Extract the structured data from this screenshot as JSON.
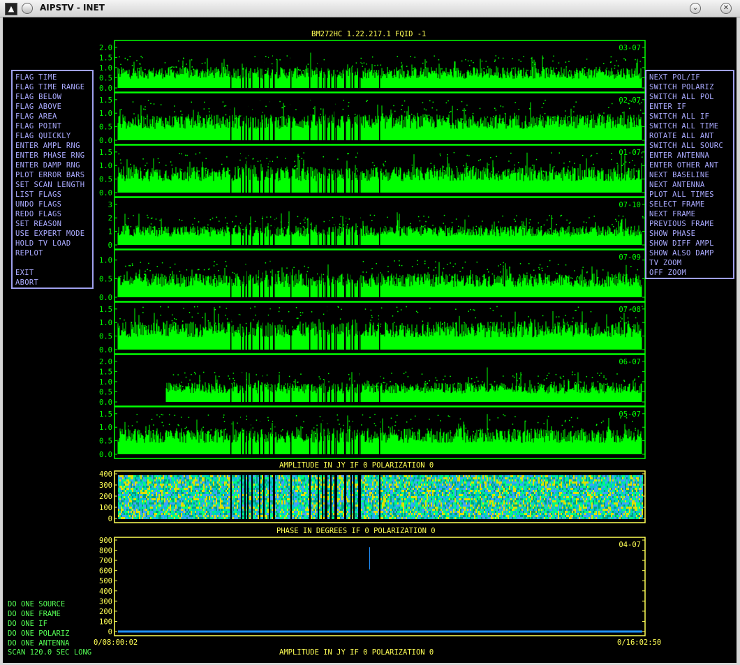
{
  "window": {
    "title": "AIPSTV - INET",
    "icon_name": "aips-app-icon",
    "buttons": [
      "window-menu-button",
      "minimize-button",
      "close-button"
    ]
  },
  "header": "BM272HC 1.22.217.1   FQID -1",
  "left_menu": [
    "FLAG TIME",
    "FLAG TIME RANGE",
    "FLAG BELOW",
    "FLAG ABOVE",
    "FLAG AREA",
    "FLAG POINT",
    "FLAG QUICKLY",
    "ENTER AMPL RNG",
    "ENTER PHASE RNG",
    "ENTER DAMP RNG",
    "PLOT ERROR BARS",
    "SET SCAN LENGTH",
    "LIST FLAGS",
    "UNDO FLAGS",
    "REDO FLAGS",
    "SET REASON",
    "USE EXPERT MODE",
    "HOLD TV LOAD",
    "REPLOT",
    "",
    "EXIT",
    "ABORT"
  ],
  "right_menu": [
    "NEXT POL/IF",
    "SWITCH POLARIZ",
    "SWITCH ALL POL",
    "ENTER IF",
    "SWITCH ALL IF",
    "SWITCH ALL TIME",
    "ROTATE ALL ANT",
    "SWITCH ALL SOURC",
    "ENTER ANTENNA",
    "ENTER OTHER ANT",
    "NEXT BASELINE",
    "NEXT ANTENNA",
    "PLOT ALL TIMES",
    "SELECT FRAME",
    "NEXT FRAME",
    "PREVIOUS FRAME",
    "SHOW PHASE",
    "SHOW DIFF AMPL",
    "SHOW ALSO DAMP",
    "TV ZOOM",
    "OFF ZOOM"
  ],
  "bottom_menu": [
    "DO ONE SOURCE",
    "DO ONE FRAME",
    "DO ONE IF",
    "DO ONE POLARIZ",
    "DO ONE ANTENNA"
  ],
  "scan_text": "SCAN  120.0 SEC LONG",
  "time_start": "0/08:00:02",
  "time_end": "0/16:02:50",
  "captions": {
    "amp": "AMPLITUDE IN JY   IF  0   POLARIZATION 0",
    "phase": "PHASE IN DEGREES   IF  0   POLARIZATION 0",
    "bottom": "AMPLITUDE IN JY   IF  0   POLARIZATION 0"
  },
  "colors": {
    "amplitude": "#00ff00",
    "frame": "#00ff00",
    "yellow_text": "#ffff55",
    "menu_text": "#aaaaff",
    "menu_border": "#9fa0ee",
    "blue_trace": "#1e90ff"
  },
  "chart_data": [
    {
      "type": "scatter",
      "label": "03-07",
      "yticks": [
        "0.0",
        "0.5",
        "1.0",
        "1.5",
        "2.0"
      ],
      "ylim": [
        0,
        2.2
      ],
      "base_level": 0.65
    },
    {
      "type": "scatter",
      "label": "02-07",
      "yticks": [
        "0.0",
        "0.5",
        "1.0",
        "1.5"
      ],
      "ylim": [
        0,
        1.65
      ],
      "base_level": 0.6
    },
    {
      "type": "scatter",
      "label": "01-07",
      "yticks": [
        "0.0",
        "0.5",
        "1.0",
        "1.5"
      ],
      "ylim": [
        0,
        1.65
      ],
      "base_level": 0.6
    },
    {
      "type": "scatter",
      "label": "07-10",
      "yticks": [
        "0",
        "1",
        "2",
        "3"
      ],
      "ylim": [
        0,
        3.3
      ],
      "base_level": 0.9
    },
    {
      "type": "scatter",
      "label": "07-09",
      "yticks": [
        "0.0",
        "0.5",
        "1.0"
      ],
      "ylim": [
        0,
        1.2
      ],
      "base_level": 0.4
    },
    {
      "type": "scatter",
      "label": "07-08",
      "yticks": [
        "0.0",
        "0.5",
        "1.0",
        "1.5"
      ],
      "ylim": [
        0,
        1.65
      ],
      "base_level": 0.65
    },
    {
      "type": "scatter",
      "label": "06-07",
      "yticks": [
        "0.0",
        "0.5",
        "1.0",
        "1.5",
        "2.0"
      ],
      "ylim": [
        0,
        2.2
      ],
      "base_level": 0.6
    },
    {
      "type": "scatter",
      "label": "05-07",
      "yticks": [
        "0.0",
        "0.5",
        "1.0",
        "1.5"
      ],
      "ylim": [
        0,
        1.65
      ],
      "base_level": 0.6
    },
    {
      "type": "heatmap",
      "label": "04-07",
      "yticks": [
        "0",
        "100",
        "200",
        "300",
        "400"
      ],
      "ylim": [
        0,
        400
      ]
    },
    {
      "type": "scatter",
      "label": "04-07",
      "yticks": [
        "0",
        "100",
        "200",
        "300",
        "400",
        "500",
        "600",
        "700",
        "800",
        "900"
      ],
      "ylim": [
        0,
        900
      ],
      "base_level": 0
    }
  ]
}
